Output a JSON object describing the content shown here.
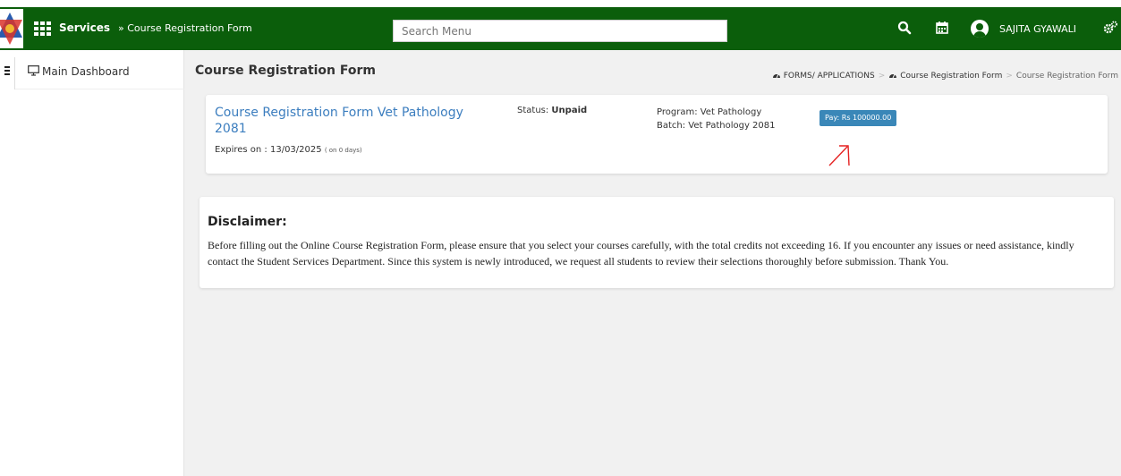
{
  "topbar": {
    "services_label": "Services",
    "breadcrumb_label": "» Course Registration Form",
    "search_placeholder": "Search Menu",
    "user_name": "SAJITA GYAWALI",
    "bg_color": "#0b5e0b"
  },
  "sidebar": {
    "items": [
      {
        "label": "Main Dashboard",
        "icon": "monitor-icon"
      }
    ]
  },
  "page": {
    "title": "Course Registration Form",
    "breadcrumb": [
      "FORMS/ APPLICATIONS",
      "Course Registration Form",
      "Course Registration Form"
    ]
  },
  "form_card": {
    "title": "Course Registration Form Vet Pathology 2081",
    "expires_label": "Expires on : 13/03/2025",
    "expires_note": "( on 0 days)",
    "status_label": "Status:",
    "status_value": "Unpaid",
    "program": "Program: Vet Pathology",
    "batch": "Batch: Vet Pathology 2081",
    "pay_label": "Pay: Rs 100000.00",
    "pay_color": "#3a87b8"
  },
  "disclaimer": {
    "title": "Disclaimer:",
    "text": "Before filling out the Online Course Registration Form, please ensure that you select your courses carefully, with the total credits not exceeding 16. If you encounter any issues or need assistance, kindly contact the Student Services Department. Since this system is newly introduced, we request all students to review their selections thoroughly before submission. Thank You."
  }
}
